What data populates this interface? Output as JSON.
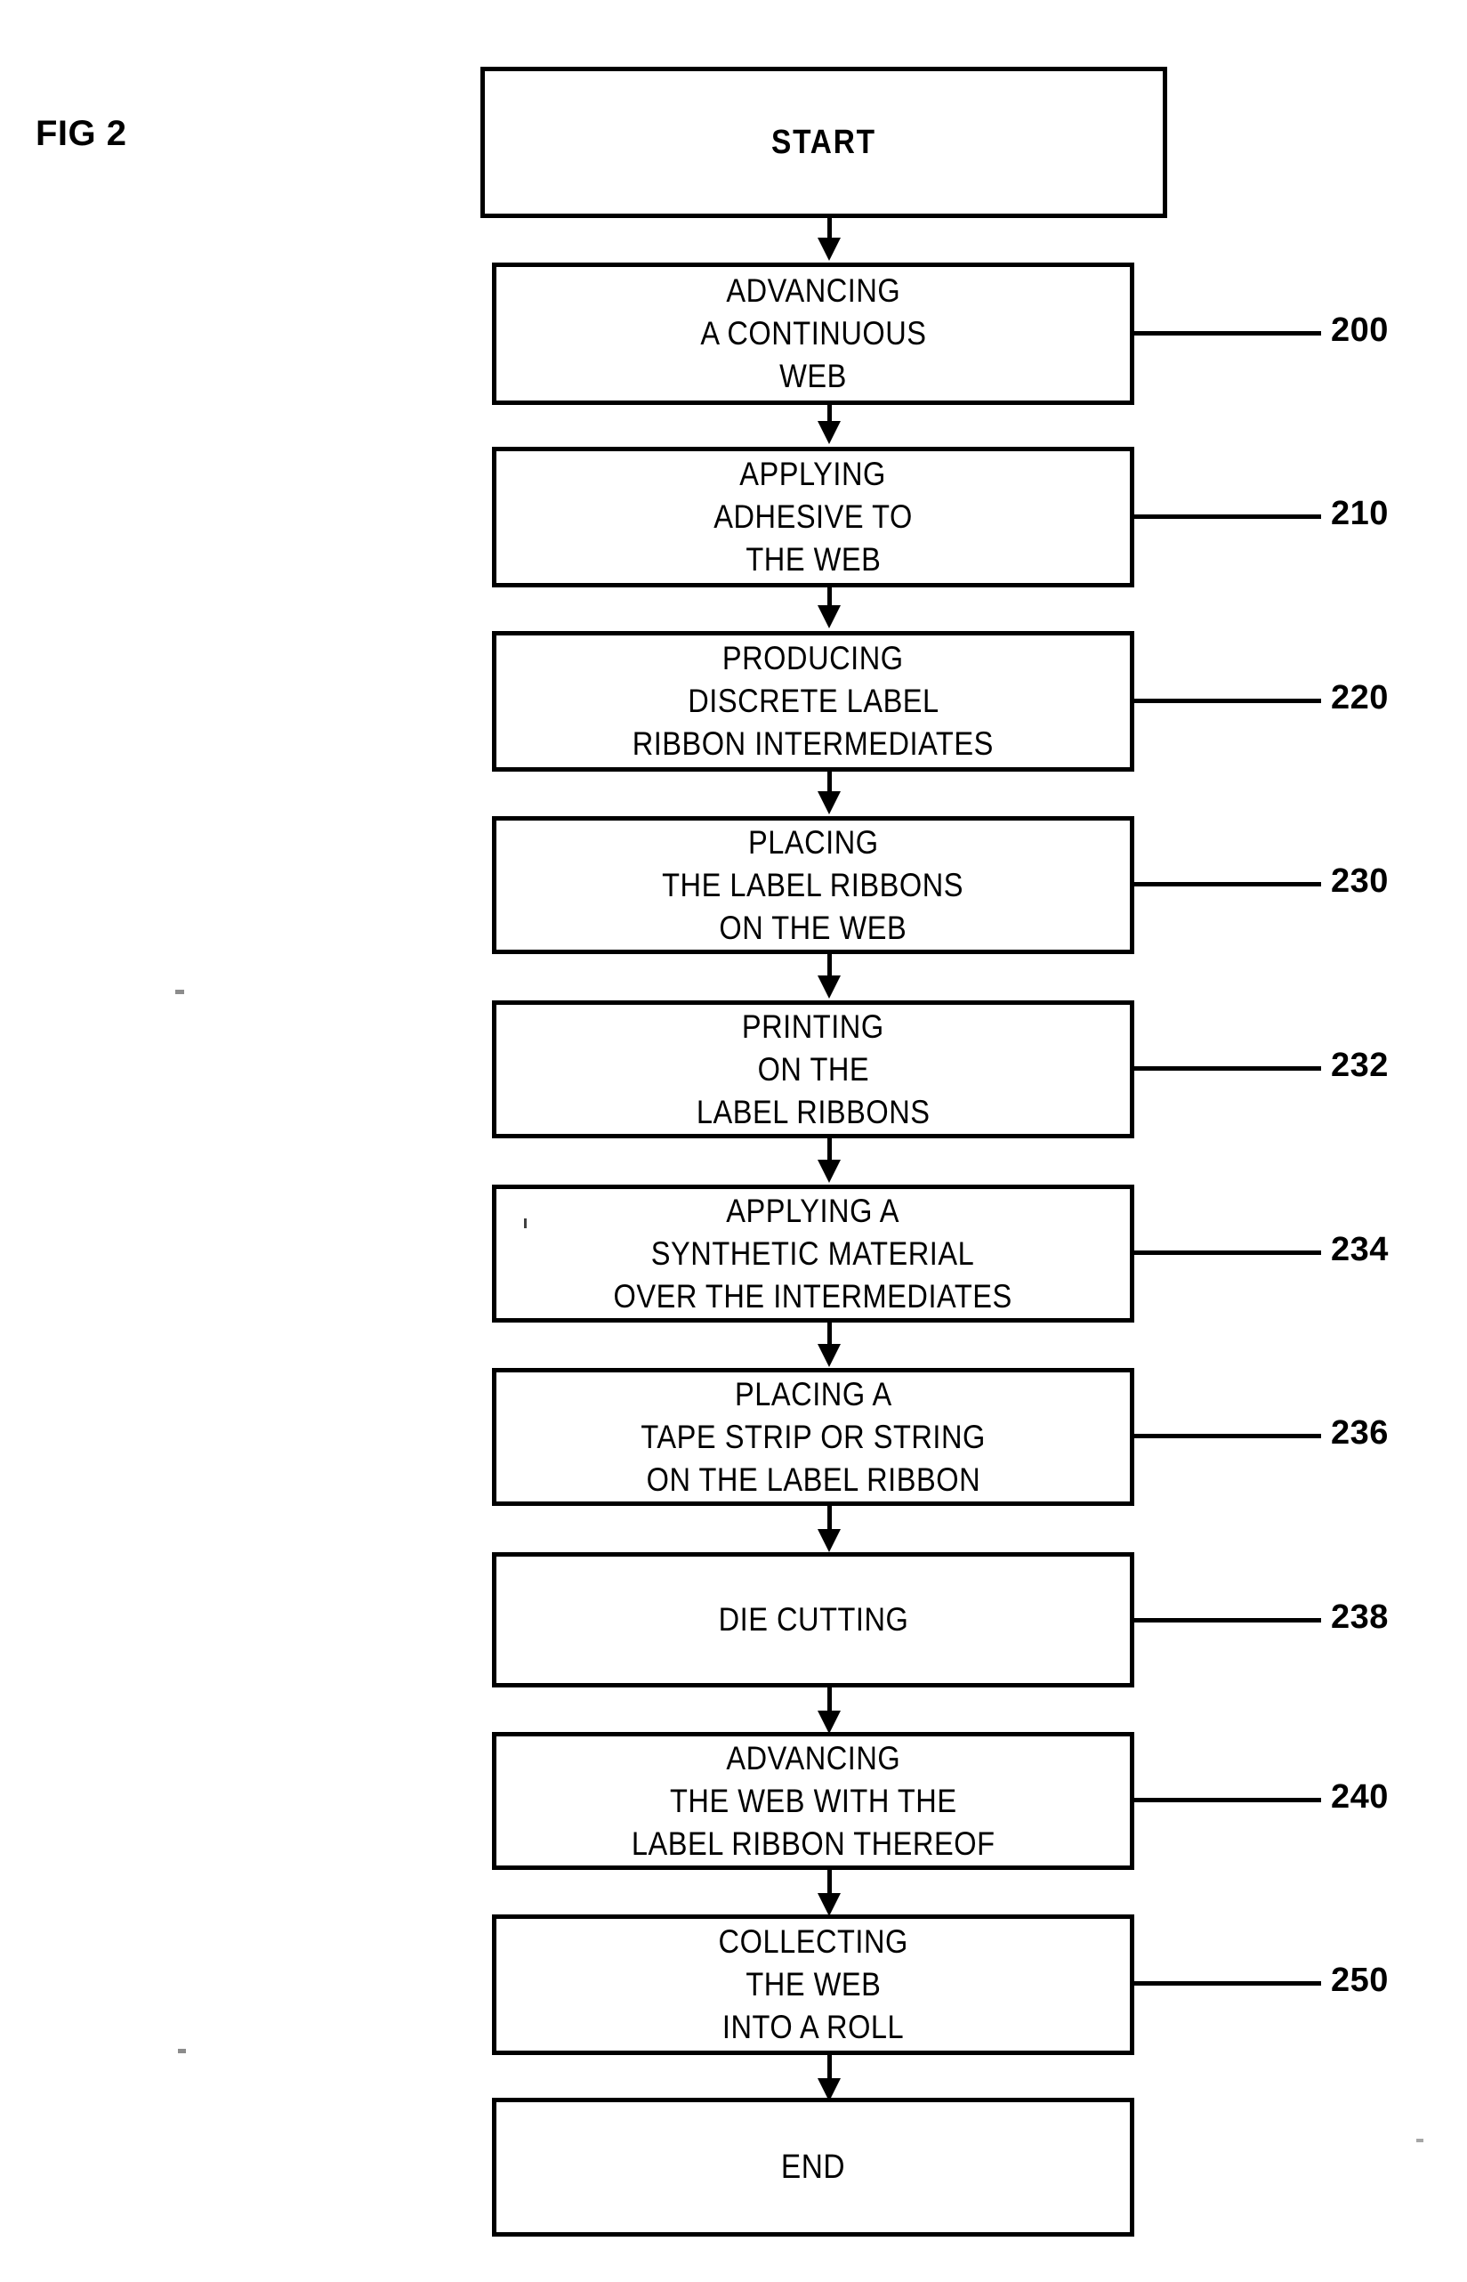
{
  "figure": {
    "label": "FIG 2",
    "type": "process-flowchart"
  },
  "flow": {
    "nodes": [
      {
        "id": "start",
        "kind": "terminal",
        "ref": "",
        "lines": [
          "START"
        ]
      },
      {
        "id": "advancing-web",
        "kind": "process",
        "ref": "200",
        "lines": [
          "ADVANCING",
          "A CONTINUOUS",
          "WEB"
        ]
      },
      {
        "id": "applying-adhesive",
        "kind": "process",
        "ref": "210",
        "lines": [
          "APPLYING",
          "ADHESIVE TO",
          "THE WEB"
        ]
      },
      {
        "id": "producing-intermediates",
        "kind": "process",
        "ref": "220",
        "lines": [
          "PRODUCING",
          "DISCRETE LABEL",
          "RIBBON INTERMEDIATES"
        ]
      },
      {
        "id": "placing-ribbons",
        "kind": "process",
        "ref": "230",
        "lines": [
          "PLACING",
          "THE LABEL RIBBONS",
          "ON THE WEB"
        ]
      },
      {
        "id": "printing-ribbons",
        "kind": "process",
        "ref": "232",
        "lines": [
          "PRINTING",
          "ON THE",
          "LABEL RIBBONS"
        ]
      },
      {
        "id": "applying-synthetic",
        "kind": "process",
        "ref": "234",
        "lines": [
          "APPLYING A",
          "SYNTHETIC MATERIAL",
          "OVER THE INTERMEDIATES"
        ]
      },
      {
        "id": "placing-tape",
        "kind": "process",
        "ref": "236",
        "lines": [
          "PLACING A",
          "TAPE STRIP OR STRING",
          "ON THE LABEL RIBBON"
        ]
      },
      {
        "id": "die-cutting",
        "kind": "process",
        "ref": "238",
        "lines": [
          "DIE CUTTING"
        ]
      },
      {
        "id": "advancing-with-ribbon",
        "kind": "process",
        "ref": "240",
        "lines": [
          "ADVANCING",
          "THE WEB WITH THE",
          "LABEL RIBBON THEREOF"
        ]
      },
      {
        "id": "collecting-roll",
        "kind": "process",
        "ref": "250",
        "lines": [
          "COLLECTING",
          "THE WEB",
          "INTO A ROLL"
        ]
      },
      {
        "id": "end",
        "kind": "terminal",
        "ref": "",
        "lines": [
          "END"
        ]
      }
    ],
    "reference_numerals": [
      "200",
      "210",
      "220",
      "230",
      "232",
      "234",
      "236",
      "238",
      "240",
      "250"
    ]
  },
  "style": {
    "stroke_color": "#000000",
    "fill_color": "#ffffff",
    "background": "#ffffff"
  }
}
